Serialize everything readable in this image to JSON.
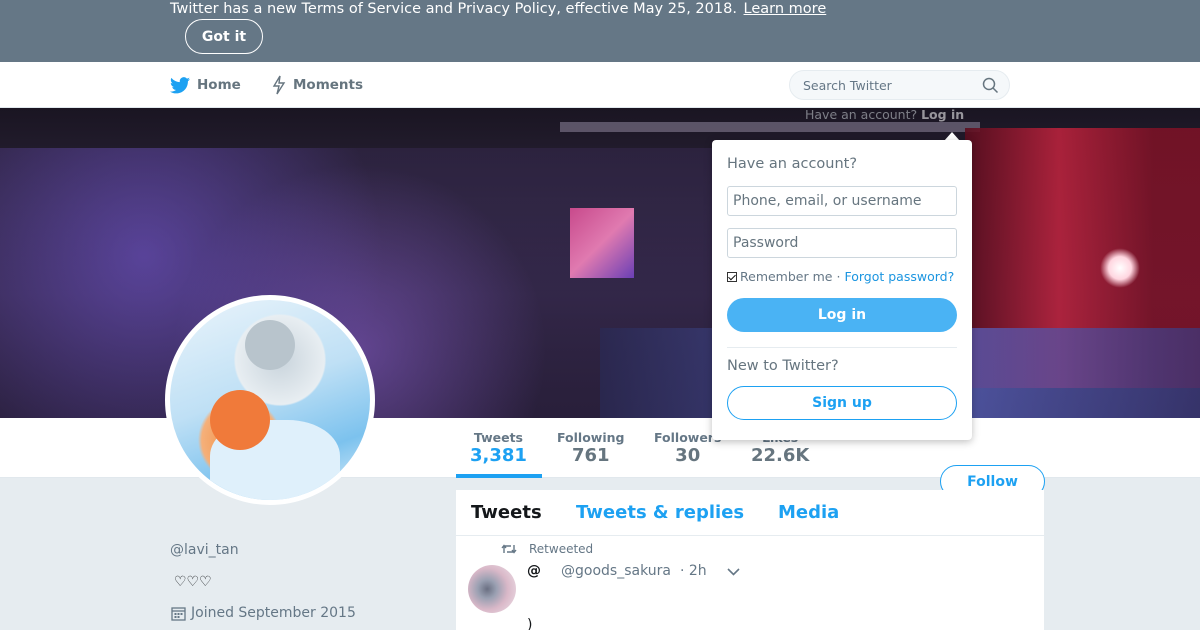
{
  "banner": {
    "text": "Twitter has a new Terms of Service and Privacy Policy, effective May 25, 2018.",
    "link": "Learn more",
    "got_it": "Got it"
  },
  "nav": {
    "home": "Home",
    "moments": "Moments",
    "search_placeholder": "Search Twitter",
    "login_hint_prefix": "Have an account?",
    "login_hint_link": "Log in"
  },
  "stats": [
    {
      "label": "Tweets",
      "value": "3,381",
      "active": true
    },
    {
      "label": "Following",
      "value": "761"
    },
    {
      "label": "Followers",
      "value": "30"
    },
    {
      "label": "Likes",
      "value": "22.6K"
    }
  ],
  "follow_button": "Follow",
  "profile": {
    "display_name": "",
    "handle": "@lavi_tan",
    "bio": "♡♡♡",
    "joined": "Joined September 2015"
  },
  "timeline": {
    "tabs": [
      "Tweets",
      "Tweets & replies",
      "Media"
    ],
    "retweeted_label": "Retweeted",
    "tweet": {
      "name": "@",
      "handle": "@goods_sakura",
      "time": "· 2h",
      "text": ")"
    }
  },
  "login_dropdown": {
    "heading": "Have an account?",
    "username_placeholder": "Phone, email, or username",
    "password_placeholder": "Password",
    "remember": "Remember me",
    "forgot": "Forgot password?",
    "login_button": "Log in",
    "new_heading": "New to Twitter?",
    "signup_button": "Sign up"
  },
  "colors": {
    "brand": "#1da1f2",
    "banner_bg": "#657786",
    "page_bg": "#e6ecf0"
  },
  "icons": [
    "twitter-bird-icon",
    "lightning-icon",
    "search-icon",
    "retweet-icon",
    "chevron-down-icon",
    "calendar-icon"
  ]
}
